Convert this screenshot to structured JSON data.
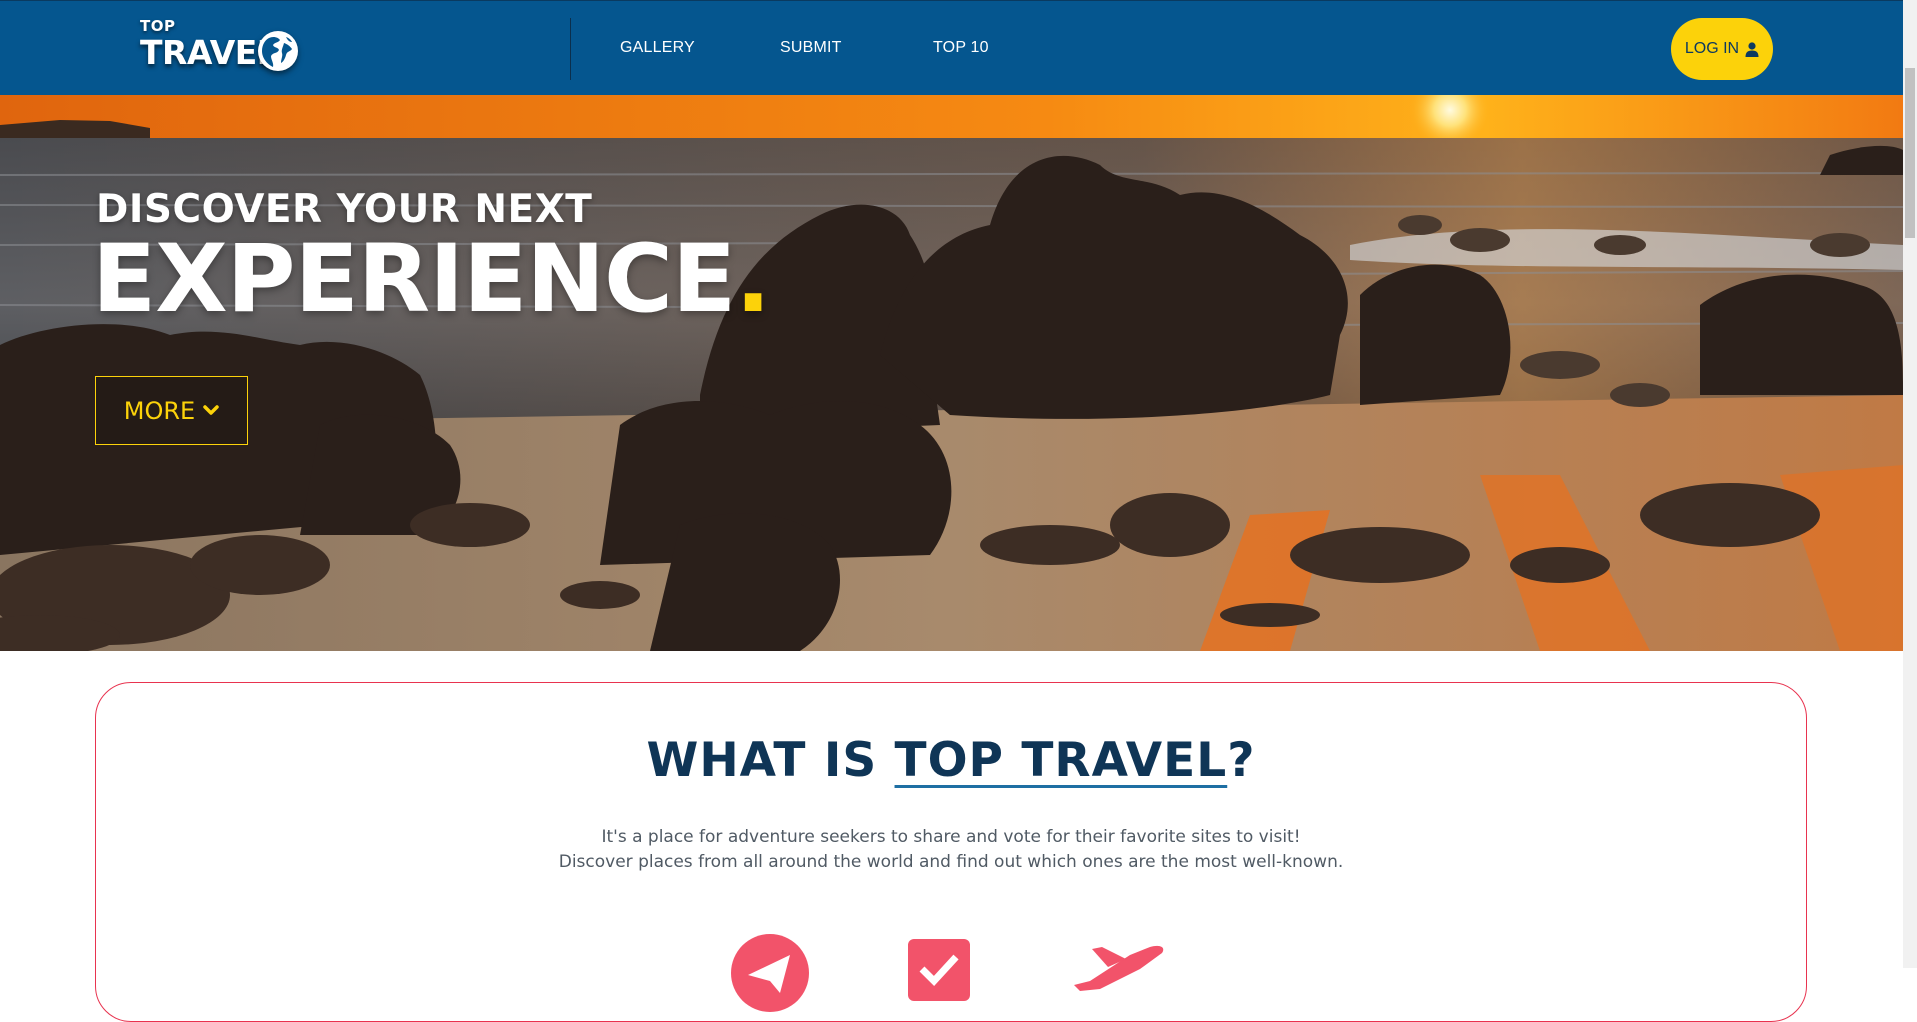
{
  "navbar": {
    "logo_top": "TOP",
    "logo_main": "TRAVEL",
    "links": [
      "GALLERY",
      "SUBMIT",
      "TOP 10"
    ],
    "login_label": "LOG IN"
  },
  "hero": {
    "subtitle": "DISCOVER YOUR NEXT",
    "title": "EXPERIENCE",
    "title_dot": ".",
    "more_label": "MORE"
  },
  "info": {
    "heading_prefix": "WHAT IS ",
    "heading_brand": "TOP TRAVEL",
    "heading_suffix": "?",
    "line1": "It's a place for adventure seekers to share and vote for their favorite sites to visit!",
    "line2": "Discover places from all around the world and find out which ones are the most well-known."
  },
  "colors": {
    "navbar_bg": "#05568f",
    "accent_yellow": "#fcd20a",
    "card_border": "#e8334f",
    "feature_icon": "#f2536a",
    "heading": "#0f3556"
  },
  "icons": [
    "globe-icon",
    "user-icon",
    "chevron-down-icon",
    "paper-plane-icon",
    "check-square-icon",
    "airplane-icon"
  ]
}
